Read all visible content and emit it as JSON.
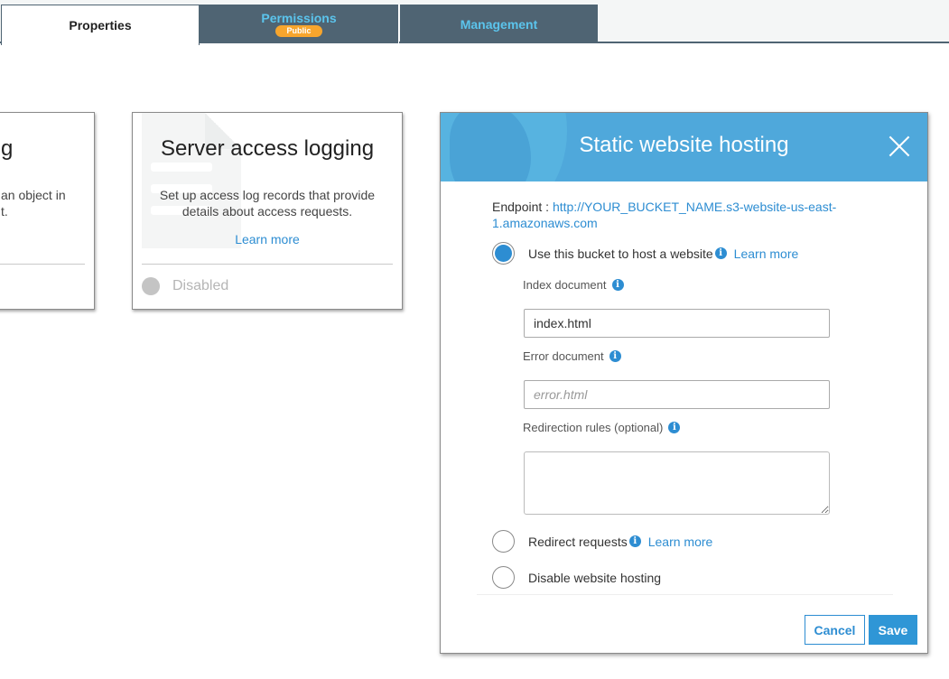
{
  "tabs": [
    {
      "label": "Properties",
      "active": true
    },
    {
      "label": "Permissions",
      "badge": "Public",
      "active": false
    },
    {
      "label": "Management",
      "active": false
    }
  ],
  "colors": {
    "accent": "#2d8dd2",
    "tab_dark": "#4f6473",
    "tab_text": "#5bc4ec",
    "badge": "#f7a52d",
    "modal_header": "#4fa8db"
  },
  "cards": {
    "left": {
      "title_fragment": "g",
      "desc_line1": "an object in",
      "desc_line2": "t."
    },
    "server_access_logging": {
      "title": "Server access logging",
      "description": "Set up access log records that provide details about access requests.",
      "link": "Learn more",
      "status": "Disabled",
      "icon": "document-icon"
    }
  },
  "modal": {
    "title": "Static website hosting",
    "close_icon": "close-icon",
    "endpoint_label": "Endpoint :",
    "endpoint_url": "http://YOUR_BUCKET_NAME.s3-website-us-east-1.amazonaws.com",
    "options": [
      {
        "label": "Use this bucket to host a website",
        "link": "Learn more",
        "checked": true
      },
      {
        "label": "Redirect requests",
        "link": "Learn more",
        "checked": false
      },
      {
        "label": "Disable website hosting",
        "checked": false
      }
    ],
    "index_document": {
      "label": "Index document",
      "value": "index.html"
    },
    "error_document": {
      "label": "Error document",
      "placeholder": "error.html",
      "value": ""
    },
    "redirection_rules": {
      "label": "Redirection rules (optional)",
      "value": ""
    },
    "info_glyph": "i",
    "cancel_label": "Cancel",
    "save_label": "Save"
  }
}
